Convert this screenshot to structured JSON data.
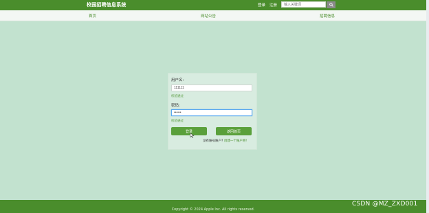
{
  "header": {
    "site_title": "校园招聘信息系统",
    "login_label": "登录",
    "register_label": "注册",
    "search_placeholder": "输入关键词"
  },
  "nav": {
    "items": [
      {
        "label": "首页"
      },
      {
        "label": "网站公告"
      },
      {
        "label": "招聘信息"
      }
    ]
  },
  "login": {
    "username_label": "用户名:",
    "username_value": "111111",
    "username_hint": "校验通过",
    "password_label": "密码:",
    "password_value": "••••••",
    "password_hint": "校验通过",
    "login_button": "登录",
    "back_button": "返回首页",
    "no_account_text": "没有账号账户?",
    "create_account_link": "创建一个账户吧!"
  },
  "footer": {
    "copyright": "Copyright © 2024 Apple Inc. All rights reserved."
  },
  "watermark": {
    "text": "CSDN @MZ_ZXD001"
  },
  "colors": {
    "brand_green": "#4a8d2c",
    "button_green": "#5aa03b",
    "page_background": "#c2e2cf"
  },
  "icons": {
    "search": "search-icon",
    "cursor": "mouse-pointer-icon"
  }
}
